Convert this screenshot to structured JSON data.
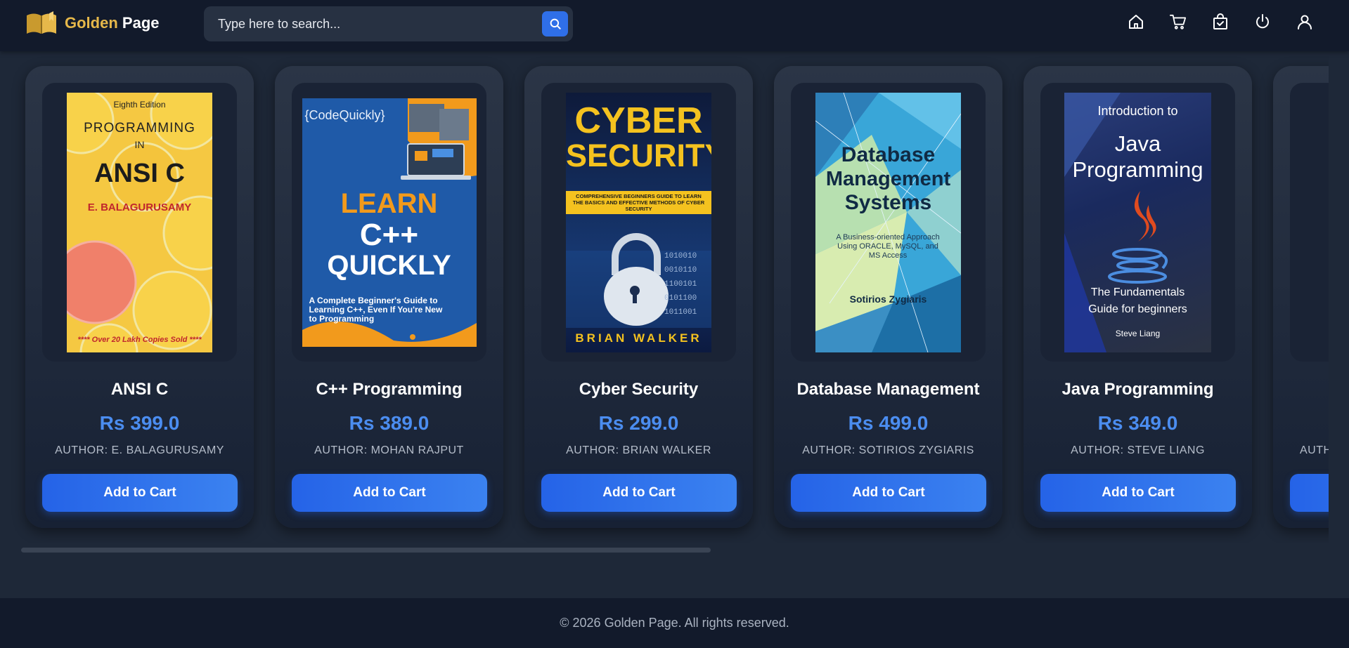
{
  "header": {
    "logo_gold": "Golden",
    "logo_white": "Page",
    "search_placeholder": "Type here to search..."
  },
  "icons": {
    "search": "search-icon",
    "nav": [
      "home-icon",
      "cart-icon",
      "orders-icon",
      "power-icon",
      "user-icon"
    ]
  },
  "colors": {
    "accent": "#2f6fe8",
    "price": "#4b8df0",
    "gold": "#e6b84a",
    "header_bg": "#121a2b",
    "page_bg": "#1e2838"
  },
  "books": [
    {
      "title": "ANSI C",
      "price": "Rs 399.0",
      "author": "AUTHOR: E. BALAGURUSAMY",
      "button": "Add to Cart",
      "cover": {
        "edition": "Eighth Edition",
        "line1": "PROGRAMMING",
        "line2": "IN",
        "line3": "ANSI C",
        "author": "E. BALAGURUSAMY",
        "footer": "**** Over 20 Lakh Copies Sold ****"
      }
    },
    {
      "title": "C++ Programming",
      "price": "Rs 389.0",
      "author": "AUTHOR: MOHAN RAJPUT",
      "button": "Add to Cart",
      "cover": {
        "brand": "{CodeQuickly}",
        "line1": "LEARN",
        "line2": "C++",
        "line3": "QUICKLY",
        "subtitle": "A Complete Beginner's Guide to Learning C++, Even If You're New to Programming"
      }
    },
    {
      "title": "Cyber Security",
      "price": "Rs 299.0",
      "author": "AUTHOR: BRIAN WALKER",
      "button": "Add to Cart",
      "cover": {
        "line1": "CYBER",
        "line2": "SECURITY",
        "subtitle": "COMPREHENSIVE BEGINNERS GUIDE TO LEARN THE BASICS AND EFFECTIVE METHODS OF CYBER SECURITY",
        "author": "BRIAN WALKER"
      }
    },
    {
      "title": "Database Management",
      "price": "Rs 499.0",
      "author": "AUTHOR: SOTIRIOS ZYGIARIS",
      "button": "Add to Cart",
      "cover": {
        "line1": "Database",
        "line2": "Management",
        "line3": "Systems",
        "subtitle": "A Business-oriented Approach Using ORACLE, MySQL, and MS Access",
        "author": "Sotirios Zygiaris"
      }
    },
    {
      "title": "Java Programming",
      "price": "Rs 349.0",
      "author": "AUTHOR: STEVE LIANG",
      "button": "Add to Cart",
      "cover": {
        "intro": "Introduction to",
        "line1": "Java",
        "line2": "Programming",
        "subtitle1": "The Fundamentals",
        "subtitle2": "Guide for beginners",
        "author": "Steve Liang"
      }
    },
    {
      "title": "",
      "price": "",
      "author": "AUTH",
      "button": ""
    }
  ],
  "footer": {
    "copyright": "© 2026 Golden Page. All rights reserved."
  }
}
